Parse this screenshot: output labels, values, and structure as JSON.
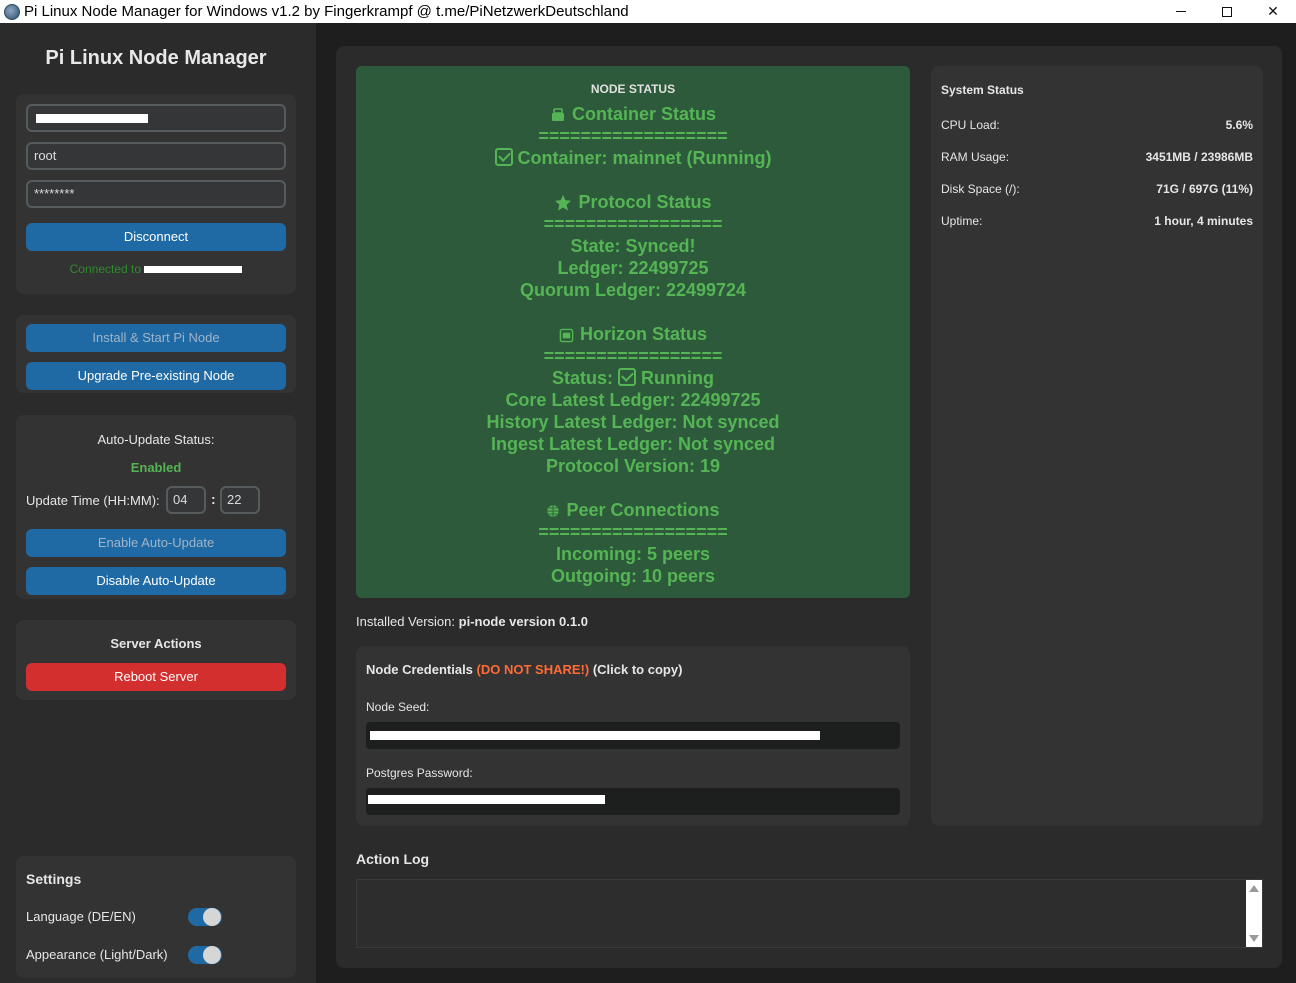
{
  "window": {
    "title": "Pi Linux Node Manager for Windows v1.2 by Fingerkrampf @ t.me/PiNetzwerkDeutschland",
    "minimize_glyph": "",
    "maximize_glyph": "",
    "close_glyph": "✕"
  },
  "sidebar": {
    "title": "Pi Linux Node Manager",
    "connection": {
      "host_value": "",
      "username_value": "root",
      "password_value": "********",
      "disconnect_label": "Disconnect",
      "status_text": "Connected to"
    },
    "node_actions": {
      "install_label": "Install & Start Pi Node",
      "upgrade_label": "Upgrade Pre-existing Node"
    },
    "auto_update": {
      "status_label": "Auto-Update Status:",
      "status_value": "Enabled",
      "time_label": "Update Time (HH:MM):",
      "hour": "04",
      "minute": "22",
      "separator": ":",
      "enable_label": "Enable Auto-Update",
      "disable_label": "Disable Auto-Update"
    },
    "server_actions": {
      "title": "Server Actions",
      "reboot_label": "Reboot Server"
    },
    "settings": {
      "title": "Settings",
      "language_label": "Language (DE/EN)",
      "language_on": true,
      "appearance_label": "Appearance (Light/Dark)",
      "appearance_on": true
    }
  },
  "node_status": {
    "heading": "NODE STATUS",
    "container_title": "Container Status",
    "divider1": "==================",
    "container_line": "Container: mainnet (Running)",
    "protocol_title": "Protocol Status",
    "divider2": "=================",
    "state": "State: Synced!",
    "ledger": "Ledger: 22499725",
    "quorum": "Quorum Ledger: 22499724",
    "horizon_title": "Horizon Status",
    "divider3": "=================",
    "horizon_status_prefix": "Status:",
    "horizon_status_value": "Running",
    "core_latest": "Core Latest Ledger: 22499725",
    "history_latest": "History Latest Ledger: Not synced",
    "ingest_latest": "Ingest Latest Ledger: Not synced",
    "protocol_version": "Protocol Version: 19",
    "peer_title": "Peer Connections",
    "divider4": "==================",
    "incoming": "Incoming: 5 peers",
    "outgoing": "Outgoing: 10 peers"
  },
  "system_status": {
    "title": "System Status",
    "rows": [
      {
        "label": "CPU Load:",
        "value": "5.6%"
      },
      {
        "label": "RAM Usage:",
        "value": "3451MB / 23986MB"
      },
      {
        "label": "Disk Space (/):",
        "value": "71G / 697G (11%)"
      },
      {
        "label": "Uptime:",
        "value": "1 hour, 4 minutes"
      }
    ]
  },
  "installed": {
    "label": "Installed Version:",
    "value": "pi-node version 0.1.0"
  },
  "credentials": {
    "title": "Node Credentials",
    "warning": "(DO NOT SHARE!)",
    "hint": "(Click to copy)",
    "seed_label": "Node Seed:",
    "postgres_label": "Postgres Password:"
  },
  "action_log": {
    "title": "Action Log",
    "content": ""
  },
  "colors": {
    "accent_blue": "#1f6aa5",
    "danger_red": "#d32f2f",
    "status_green": "#55b555",
    "status_bg": "#2d5a3a",
    "warning_orange": "#ff6b35"
  }
}
